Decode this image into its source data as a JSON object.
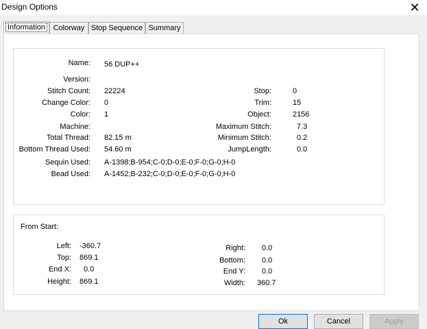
{
  "window": {
    "title": "Design Options"
  },
  "tabs": [
    "Information",
    "Colorway",
    "Stop Sequence",
    "Summary"
  ],
  "info": {
    "left_rows": [
      {
        "label": "Name:",
        "value": "56 DUP++"
      },
      {
        "label": "Version:",
        "value": ""
      },
      {
        "label": "Stitch Count:",
        "value": "22224"
      },
      {
        "label": "Change Color:",
        "value": "0"
      },
      {
        "label": "Color:",
        "value": "1"
      },
      {
        "label": "Machine:",
        "value": ""
      },
      {
        "label": "Total Thread:",
        "value": "82.15 m"
      },
      {
        "label": "Bottom Thread Used:",
        "value": "54.60 m"
      },
      {
        "label": "Sequin Used:",
        "value": "A-1398;B-954;C-0;D-0;E-0;F-0;G-0;H-0"
      },
      {
        "label": "Bead Used:",
        "value": "A-1452;B-232;C-0;D-0;E-0;F-0;G-0;H-0"
      }
    ],
    "right_rows": [
      {
        "label": "Stop:",
        "value": "0"
      },
      {
        "label": "Trim:",
        "value": "15"
      },
      {
        "label": "Object:",
        "value": "2156"
      },
      {
        "label": "Maximum Stitch:",
        "value": "7.3"
      },
      {
        "label": "Minimum Stitch:",
        "value": "0.2"
      },
      {
        "label": "JumpLength:",
        "value": "0.0"
      }
    ]
  },
  "from_start": {
    "title": "From Start:",
    "left": [
      {
        "label": "Left:",
        "value": "-360.7"
      },
      {
        "label": "Top:",
        "value": "869.1"
      },
      {
        "label": "End X:",
        "value": "0.0"
      },
      {
        "label": "Height:",
        "value": "869.1"
      }
    ],
    "right": [
      {
        "label": "Right:",
        "value": "0.0"
      },
      {
        "label": "Bottom:",
        "value": "0.0"
      },
      {
        "label": "End Y:",
        "value": "0.0"
      },
      {
        "label": "Width:",
        "value": "360.7"
      }
    ]
  },
  "buttons": {
    "ok": "Ok",
    "cancel": "Cancel",
    "apply": "Apply"
  }
}
